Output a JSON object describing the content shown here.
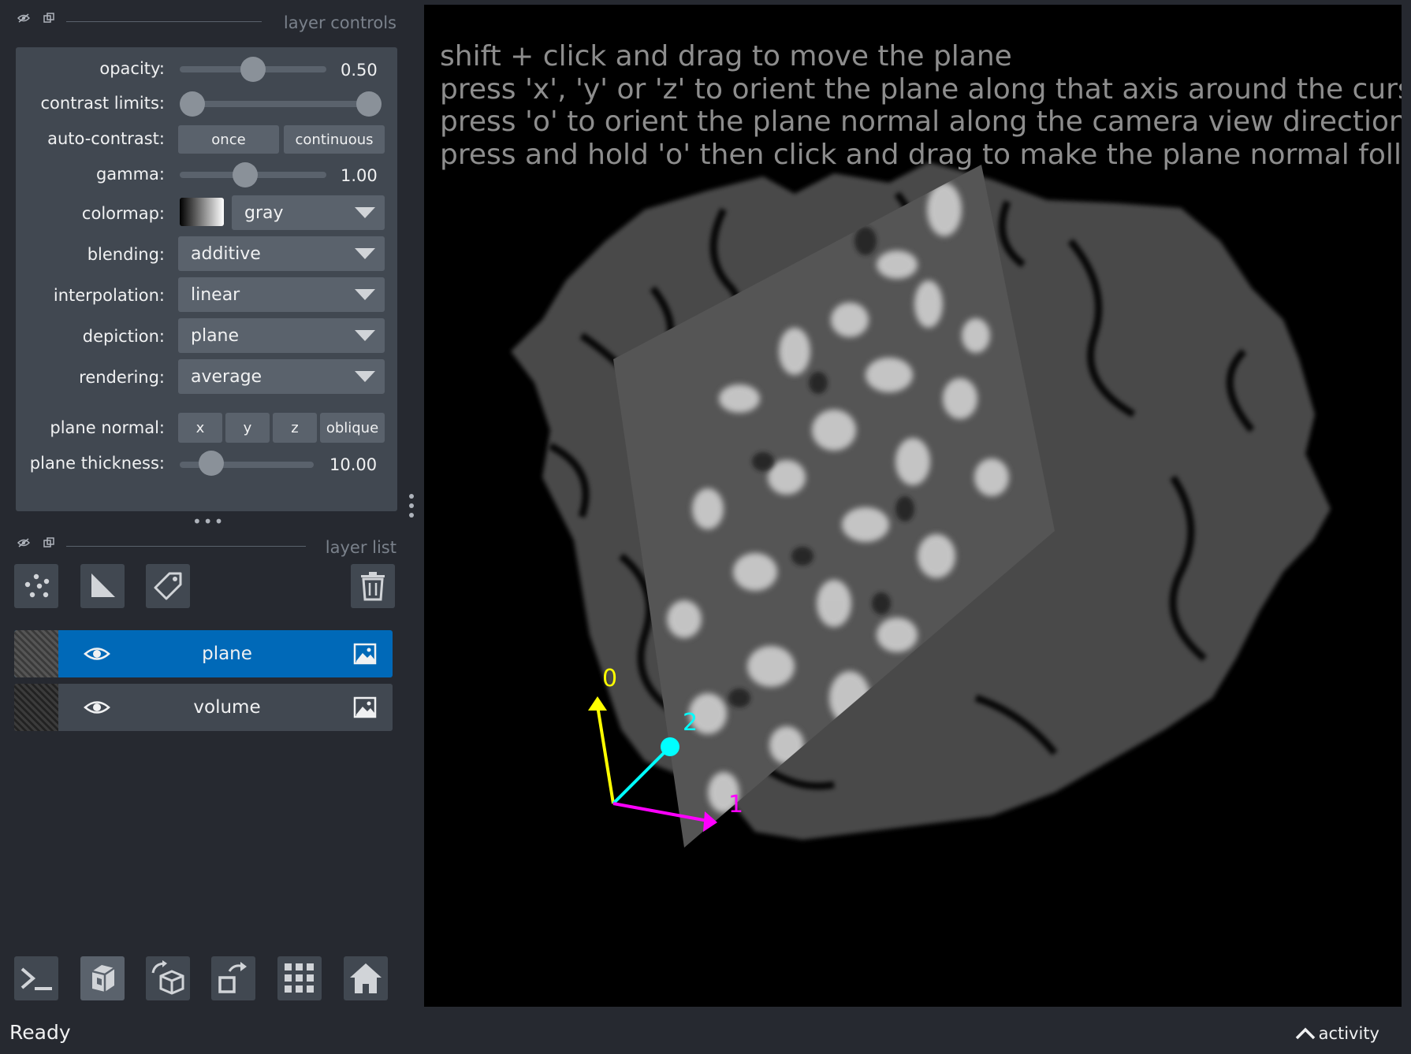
{
  "layer_controls": {
    "title": "layer controls",
    "opacity": {
      "label": "opacity:",
      "value": "0.50",
      "level": 0.5
    },
    "contrast_limits": {
      "label": "contrast limits:",
      "low": 0.0,
      "high": 1.0
    },
    "auto_contrast": {
      "label": "auto-contrast:",
      "once_label": "once",
      "continuous_label": "continuous"
    },
    "gamma": {
      "label": "gamma:",
      "value": "1.00",
      "level": 0.45
    },
    "colormap": {
      "label": "colormap:",
      "value": "gray"
    },
    "blending": {
      "label": "blending:",
      "value": "additive"
    },
    "interpolation": {
      "label": "interpolation:",
      "value": "linear"
    },
    "depiction": {
      "label": "depiction:",
      "value": "plane"
    },
    "rendering": {
      "label": "rendering:",
      "value": "average"
    },
    "plane_normal": {
      "label": "plane normal:",
      "x_label": "x",
      "y_label": "y",
      "z_label": "z",
      "oblique_label": "oblique"
    },
    "plane_thickness": {
      "label": "plane thickness:",
      "value": "10.00",
      "level": 0.16
    }
  },
  "layer_list": {
    "title": "layer list",
    "layers": [
      {
        "name": "plane",
        "selected": true
      },
      {
        "name": "volume",
        "selected": false
      }
    ]
  },
  "canvas": {
    "hints": [
      "shift + click and drag to move the plane",
      "press 'x', 'y' or 'z' to orient the plane along that axis around the cursor",
      "press 'o' to orient the plane normal along the camera view direction",
      "press and hold 'o' then click and drag to make the plane normal follow the"
    ],
    "axes": {
      "axis_0": "0",
      "axis_1": "1",
      "axis_2": "2"
    }
  },
  "status": {
    "text": "Ready",
    "activity_label": "activity"
  },
  "colors": {
    "background": "#262930",
    "panel": "#414851",
    "control": "#5a626c",
    "selected_layer": "#0069b8",
    "axis_0": "#ffff00",
    "axis_1": "#ff00ff",
    "axis_2": "#00ffff"
  },
  "icons": {
    "header": [
      "visibility-toggle-icon",
      "float-window-icon"
    ],
    "layer_tools": [
      "new-points-icon",
      "new-shapes-icon",
      "new-labels-icon",
      "delete-layer-icon"
    ],
    "bottom": [
      "console-icon",
      "ndisplay-icon",
      "roll-dims-icon",
      "transpose-icon",
      "grid-icon",
      "home-icon"
    ]
  }
}
